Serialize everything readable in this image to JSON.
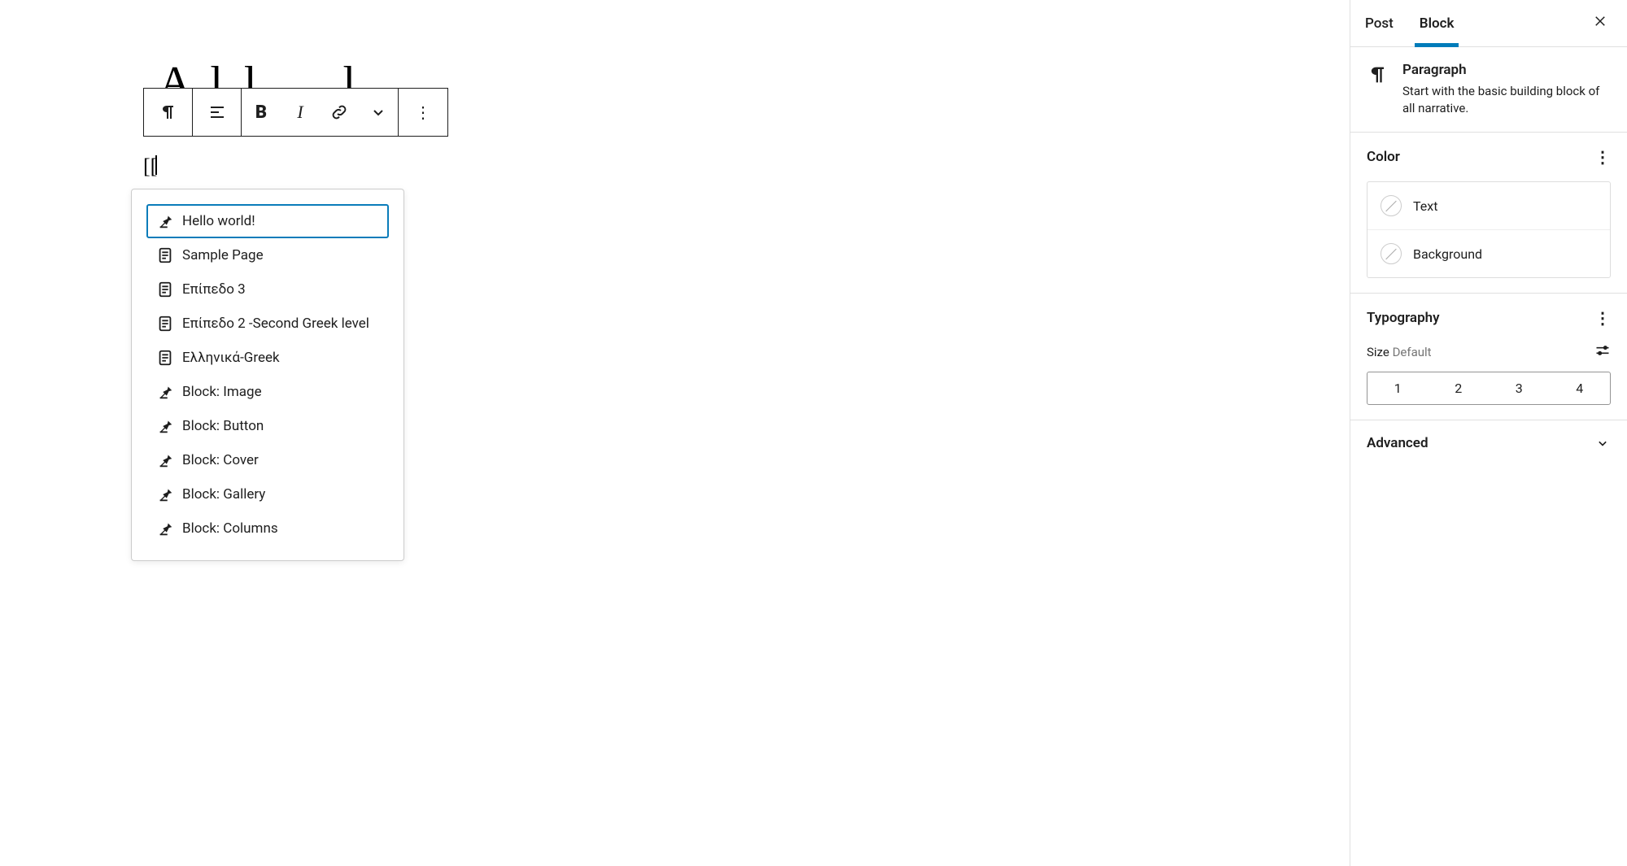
{
  "editor": {
    "title_ghost": "A  l  l  .  .  l",
    "shortcode_text": "[[",
    "popover": {
      "items": [
        {
          "label": "Hello world!",
          "icon": "pin",
          "selected": true
        },
        {
          "label": "Sample Page",
          "icon": "page",
          "selected": false
        },
        {
          "label": "Επίπεδο 3",
          "icon": "page",
          "selected": false
        },
        {
          "label": "Επίπεδο 2 -Second Greek level",
          "icon": "page",
          "selected": false
        },
        {
          "label": "Ελληνικά-Greek",
          "icon": "page",
          "selected": false
        },
        {
          "label": "Block: Image",
          "icon": "pin",
          "selected": false
        },
        {
          "label": "Block: Button",
          "icon": "pin",
          "selected": false
        },
        {
          "label": "Block: Cover",
          "icon": "pin",
          "selected": false
        },
        {
          "label": "Block: Gallery",
          "icon": "pin",
          "selected": false
        },
        {
          "label": "Block: Columns",
          "icon": "pin",
          "selected": false
        }
      ]
    }
  },
  "sidebar": {
    "tabs": {
      "post": "Post",
      "block": "Block",
      "active": "block"
    },
    "block_card": {
      "title": "Paragraph",
      "desc": "Start with the basic building block of all narrative."
    },
    "color": {
      "heading": "Color",
      "text_label": "Text",
      "background_label": "Background"
    },
    "typography": {
      "heading": "Typography",
      "size_label": "Size",
      "size_value": "Default",
      "presets": [
        "1",
        "2",
        "3",
        "4"
      ]
    },
    "advanced": {
      "heading": "Advanced"
    }
  }
}
